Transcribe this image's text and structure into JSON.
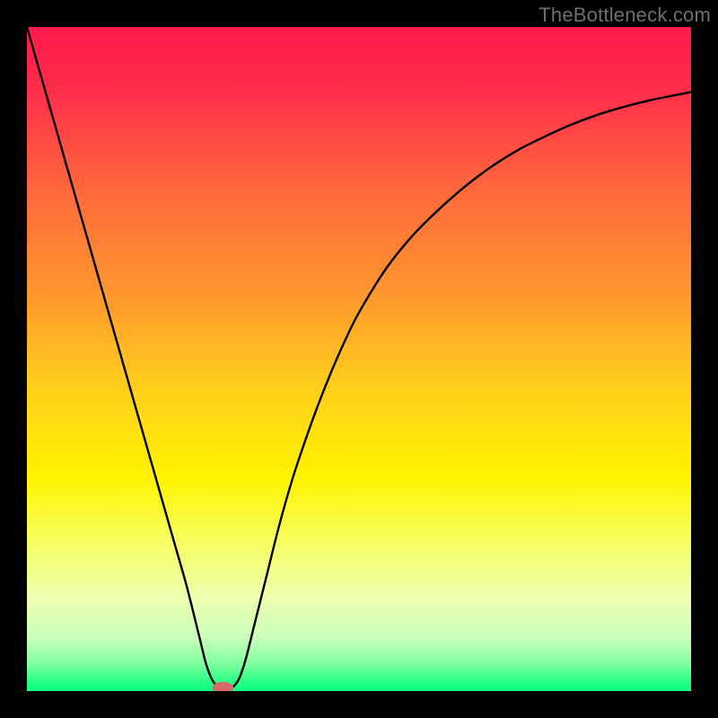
{
  "watermark": "TheBottleneck.com",
  "chart_data": {
    "type": "line",
    "title": "",
    "xlabel": "",
    "ylabel": "",
    "xlim": [
      0,
      100
    ],
    "ylim": [
      0,
      100
    ],
    "series": [
      {
        "name": "bottleneck-curve",
        "x": [
          0,
          2,
          4,
          6,
          8,
          10,
          12,
          14,
          16,
          18,
          20,
          22,
          24,
          26,
          27,
          28,
          29,
          30,
          31,
          32,
          33,
          34,
          36,
          38,
          40,
          42,
          44,
          46,
          48,
          50,
          54,
          58,
          62,
          66,
          70,
          74,
          78,
          82,
          86,
          90,
          94,
          98,
          100
        ],
        "y": [
          100,
          93,
          86,
          79,
          72,
          65,
          58,
          51,
          44,
          37,
          30,
          23,
          16,
          8,
          4,
          1.5,
          0.6,
          0.4,
          0.6,
          2,
          5,
          9,
          17,
          25,
          32,
          38,
          43.5,
          48.5,
          53,
          57,
          63.5,
          68.5,
          72.5,
          76,
          79,
          81.5,
          83.5,
          85.3,
          86.8,
          88,
          89,
          89.8,
          90.2
        ]
      }
    ],
    "marker": {
      "x": 29.5,
      "y": 0.5,
      "rx": 1.6,
      "ry": 0.9,
      "color": "#d96a6a"
    },
    "gradient_stops": [
      {
        "offset": 0,
        "color": "#ff1a4d"
      },
      {
        "offset": 0.1,
        "color": "#ff2f4a"
      },
      {
        "offset": 0.25,
        "color": "#ff6a3c"
      },
      {
        "offset": 0.4,
        "color": "#ff962f"
      },
      {
        "offset": 0.55,
        "color": "#ffd11a"
      },
      {
        "offset": 0.68,
        "color": "#fff400"
      },
      {
        "offset": 0.78,
        "color": "#f6ff66"
      },
      {
        "offset": 0.86,
        "color": "#eeffb0"
      },
      {
        "offset": 0.92,
        "color": "#c8ffb9"
      },
      {
        "offset": 0.96,
        "color": "#7dff9e"
      },
      {
        "offset": 0.985,
        "color": "#2bff87"
      },
      {
        "offset": 1.0,
        "color": "#0aff82"
      }
    ]
  }
}
